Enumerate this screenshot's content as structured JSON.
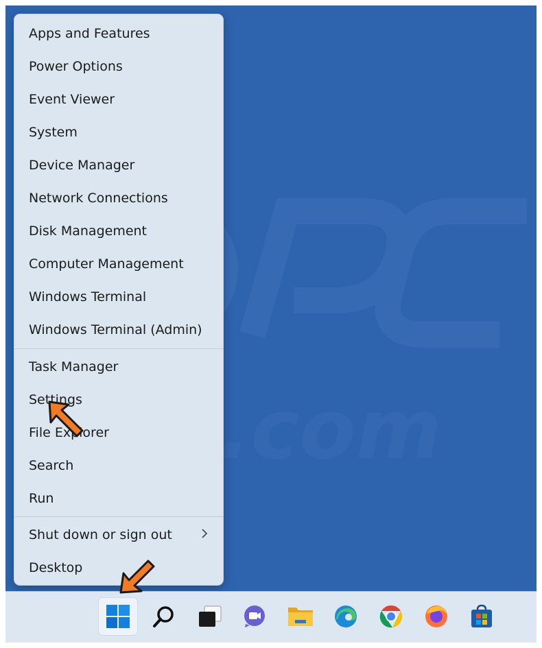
{
  "context_menu": {
    "group1": [
      {
        "label": "Apps and Features"
      },
      {
        "label": "Power Options"
      },
      {
        "label": "Event Viewer"
      },
      {
        "label": "System"
      },
      {
        "label": "Device Manager"
      },
      {
        "label": "Network Connections"
      },
      {
        "label": "Disk Management"
      },
      {
        "label": "Computer Management"
      },
      {
        "label": "Windows Terminal"
      },
      {
        "label": "Windows Terminal (Admin)"
      }
    ],
    "group2": [
      {
        "label": "Task Manager"
      },
      {
        "label": "Settings"
      },
      {
        "label": "File Explorer"
      },
      {
        "label": "Search"
      },
      {
        "label": "Run"
      }
    ],
    "group3": [
      {
        "label": "Shut down or sign out",
        "submenu_icon": "chevron-right-icon"
      },
      {
        "label": "Desktop"
      }
    ]
  },
  "taskbar": {
    "items": [
      {
        "icon": "windows-start-icon",
        "active": true
      },
      {
        "icon": "search-icon"
      },
      {
        "icon": "task-view-icon"
      },
      {
        "icon": "teams-chat-icon"
      },
      {
        "icon": "file-explorer-icon"
      },
      {
        "icon": "edge-icon"
      },
      {
        "icon": "chrome-icon"
      },
      {
        "icon": "firefox-icon"
      },
      {
        "icon": "microsoft-store-icon"
      }
    ]
  },
  "annotations": {
    "arrow_color": "#f07b22",
    "targets": [
      "Settings",
      "windows-start-icon"
    ]
  },
  "colors": {
    "desktop_bg": "#2d64ad",
    "menu_bg": "#dbe6f1",
    "taskbar_bg": "#dde7f2",
    "accent": "#0a67d0"
  }
}
